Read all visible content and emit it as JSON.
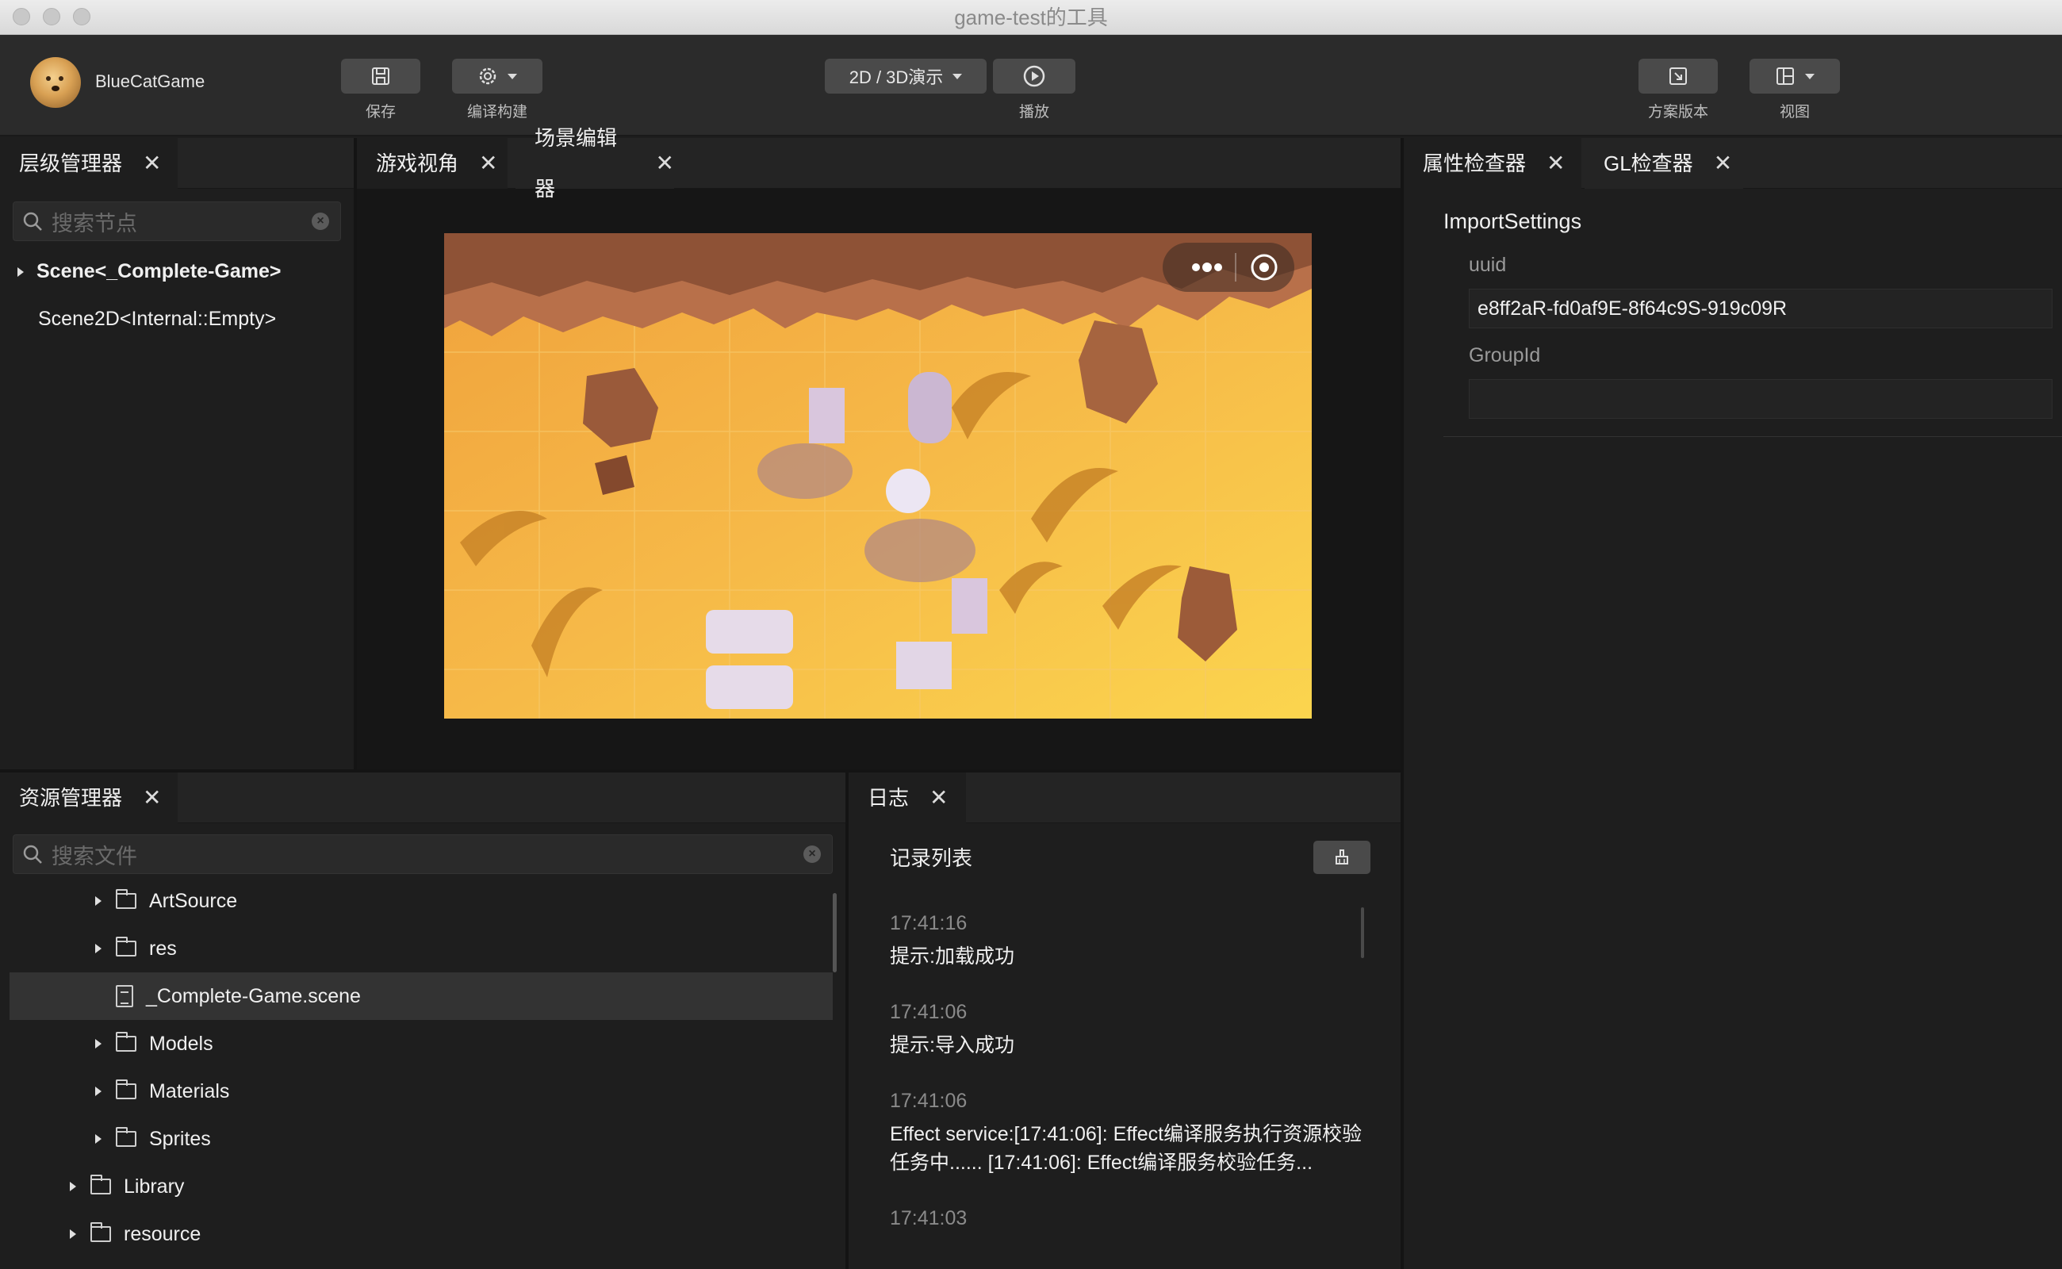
{
  "window": {
    "title": "game-test的工具"
  },
  "toolbar": {
    "username": "BlueCatGame",
    "save_label": "保存",
    "build_label": "编译构建",
    "mode_label": "2D / 3D演示",
    "play_label": "播放",
    "version_label": "方案版本",
    "view_label": "视图"
  },
  "hierarchy": {
    "tab": "层级管理器",
    "search_placeholder": "搜索节点",
    "nodes": [
      "Scene<_Complete-Game>",
      "Scene2D<Internal::Empty>"
    ]
  },
  "game_view_tab": "游戏视角",
  "scene_editor_tab": "场景编辑器",
  "inspector": {
    "tab": "属性检查器",
    "gl_tab": "GL检查器",
    "section": "ImportSettings",
    "uuid_label": "uuid",
    "uuid_value": "e8ff2aR-fd0af9E-8f64c9S-919c09R",
    "groupid_label": "GroupId",
    "groupid_value": ""
  },
  "assets": {
    "tab": "资源管理器",
    "search_placeholder": "搜索文件",
    "items": [
      "ArtSource",
      "res",
      "_Complete-Game.scene",
      "Models",
      "Materials",
      "Sprites",
      "Library",
      "resource"
    ]
  },
  "log": {
    "tab": "日志",
    "header": "记录列表",
    "entries": [
      {
        "time": "17:41:16",
        "msg": "提示:加载成功"
      },
      {
        "time": "17:41:06",
        "msg": "提示:导入成功"
      },
      {
        "time": "17:41:06",
        "msg": "Effect service:[17:41:06]: Effect编译服务执行资源校验任务中...... [17:41:06]: Effect编译服务校验任务..."
      },
      {
        "time": "17:41:03",
        "msg": ""
      }
    ]
  },
  "icons": [
    "save-icon",
    "build-icon",
    "play-icon",
    "version-icon",
    "view-icon",
    "search-icon",
    "clear-icon",
    "folder-icon",
    "file-icon",
    "broom-icon",
    "more-icon",
    "record-icon",
    "close-icon"
  ]
}
